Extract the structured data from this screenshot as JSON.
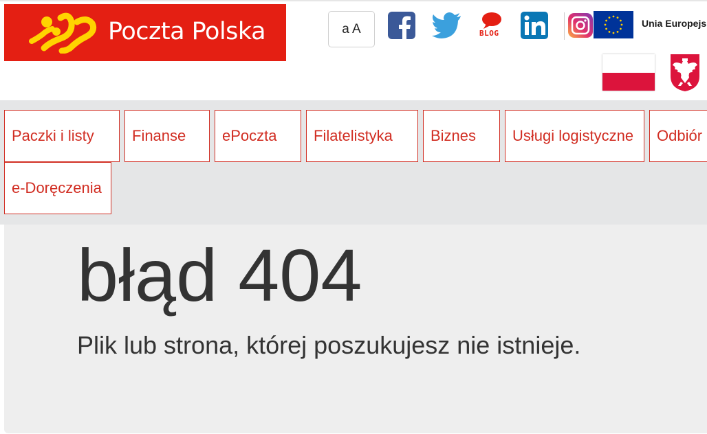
{
  "header": {
    "logo_text": "Poczta Polska",
    "font_size_toggle": "a A",
    "social": {
      "facebook": "facebook-icon",
      "twitter": "twitter-icon",
      "blog_label": "BLOG",
      "linkedin": "linkedin-icon",
      "instagram": "instagram-icon"
    },
    "eu_label": "Unia Europejska"
  },
  "nav": {
    "items": [
      {
        "label": "Paczki i listy"
      },
      {
        "label": "Finanse"
      },
      {
        "label": "ePoczta"
      },
      {
        "label": "Filatelistyka"
      },
      {
        "label": "Biznes"
      },
      {
        "label": "Usługi logistyczne"
      },
      {
        "label": "Odbiór"
      },
      {
        "label": "e-Doręczenia"
      }
    ]
  },
  "main": {
    "error_title": "błąd 404",
    "error_message": "Plik lub strona, której poszukujesz nie istnieje."
  },
  "colors": {
    "brand_red": "#e41f13",
    "nav_text": "#d12d22",
    "nav_bg": "#e5e6e7",
    "main_bg": "#eeeeee",
    "facebook": "#3b5998",
    "twitter": "#1da1f2",
    "linkedin": "#0077b5",
    "eu_blue": "#003399",
    "logo_yellow": "#ffd400"
  }
}
